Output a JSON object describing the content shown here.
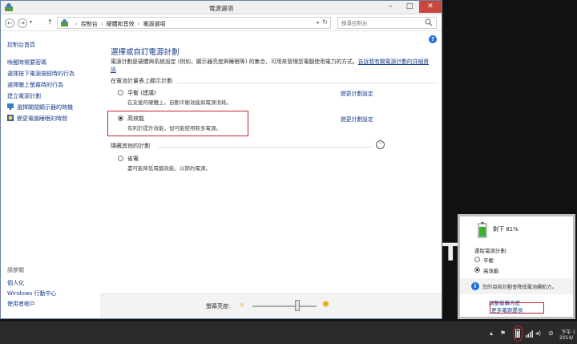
{
  "window": {
    "title": "電源選項",
    "min_label": "–",
    "max_label": "□",
    "close_label": "✕"
  },
  "address": {
    "back": "←",
    "forward": "→",
    "up": "↑",
    "crumbs": [
      "控制台",
      "硬體和音效",
      "電源選項"
    ],
    "search_placeholder": "搜尋控制台"
  },
  "leftnav": {
    "home": "控制台首頁",
    "links": [
      "喚醒時需要密碼",
      "選擇按下電源按鈕時的行為",
      "選擇闔上螢幕時的行為",
      "建立電源計劃"
    ],
    "icon_links": [
      "選擇關閉顯示器的時機",
      "變更電腦睡眠的時間"
    ],
    "see_also": "請參閱",
    "see_links": [
      "個人化",
      "Windows 行動中心",
      "使用者帳戶"
    ]
  },
  "main": {
    "help": "?",
    "title": "選擇或自訂電源計劃",
    "desc": "電源計劃是硬體與系統設定 (例如，顯示器亮度與睡眠等) 的集合，可用來管理您電腦使用電力的方式。",
    "desc_link": "告訴我有關電源計劃的詳細資訊",
    "section1": "在電池計量表上顯示計劃",
    "plans": [
      {
        "name": "平衡 (建議)",
        "desc": "在支援的硬體上，自動平衡效能與電源消耗。",
        "link": "變更計劃設定",
        "selected": false
      },
      {
        "name": "高效能",
        "desc": "有利於提升效能，但可能使用較多電源。",
        "link": "變更計劃設定",
        "selected": true
      }
    ],
    "section2": "隱藏其他的計劃",
    "hidden_plans": [
      {
        "name": "省電",
        "desc": "盡可能降低電腦效能，以節約電源。",
        "link": "",
        "selected": false
      }
    ],
    "collapse": "⌃"
  },
  "brightness": {
    "label": "螢幕亮度:",
    "value": 0.7
  },
  "background": {
    "text": "TE"
  },
  "flyout": {
    "battery_text": "剩下 81%",
    "battery_level": 0.81,
    "select_label": "選取電源計劃:",
    "options": [
      "平衡",
      "高效能"
    ],
    "selected_option": "高效能",
    "info_text": "您的目前計劃會降低電池續航力。",
    "link_brightness": "調整螢幕亮度",
    "link_more": "更多電源選項"
  },
  "taskbar": {
    "time": "下午 (",
    "date": "2014/"
  },
  "colors": {
    "link": "#1a3e8c",
    "highlight": "#c0272d",
    "close_button": "#c7473c",
    "battery_green": "#38b12f"
  }
}
